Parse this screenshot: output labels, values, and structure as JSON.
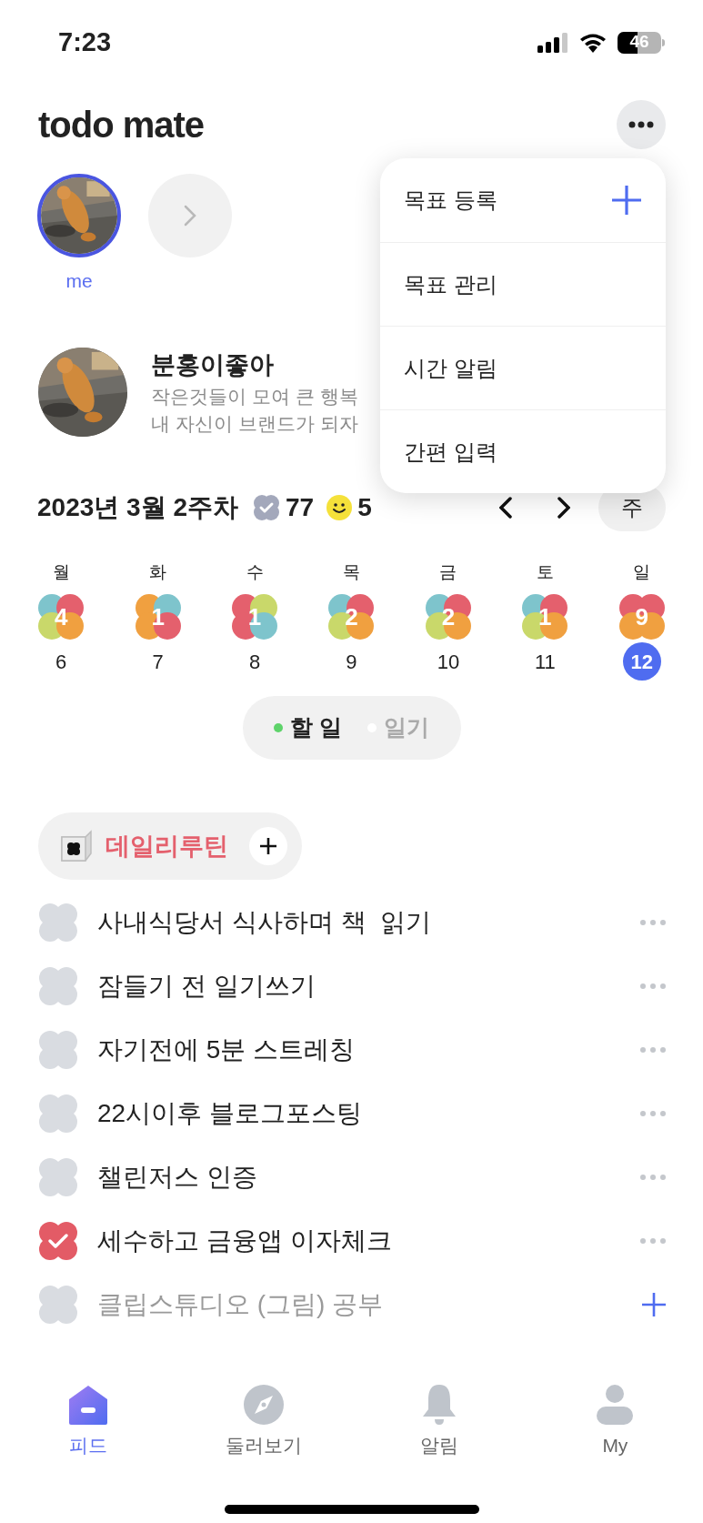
{
  "status_bar": {
    "time": "7:23",
    "battery": "46"
  },
  "header": {
    "title": "todo mate"
  },
  "friends": [
    {
      "name": "me",
      "selected": true
    }
  ],
  "menu": [
    {
      "label": "목표 등록",
      "add": true
    },
    {
      "label": "목표 관리",
      "add": false
    },
    {
      "label": "시간 알림",
      "add": false
    },
    {
      "label": "간편 입력",
      "add": false
    }
  ],
  "profile": {
    "name": "분홍이좋아",
    "bio": [
      "작은것들이 모여 큰 행복",
      "내 자신이 브랜드가 되자"
    ]
  },
  "week": {
    "title": "2023년 3월 2주차",
    "stats": [
      {
        "kind": "check",
        "value": "77"
      },
      {
        "kind": "smile",
        "value": "5"
      }
    ],
    "mode": "주"
  },
  "days": [
    {
      "weekday": "월",
      "count": "4",
      "date": "6",
      "selected": false,
      "petals": [
        {
          "color": "#7ec4cc"
        },
        {
          "color": "#e4606d"
        },
        {
          "color": "#c9d86a"
        },
        {
          "color": "#f0a040"
        }
      ]
    },
    {
      "weekday": "화",
      "count": "1",
      "date": "7",
      "selected": false,
      "petals": [
        {
          "color": "#f0a040"
        },
        {
          "color": "#7ec4cc"
        },
        {
          "color": "#f0a040"
        },
        {
          "color": "#e4606d"
        }
      ]
    },
    {
      "weekday": "수",
      "count": "1",
      "date": "8",
      "selected": false,
      "petals": [
        {
          "color": "#e4606d"
        },
        {
          "color": "#c9d86a"
        },
        {
          "color": "#e4606d"
        },
        {
          "color": "#7ec4cc"
        }
      ]
    },
    {
      "weekday": "목",
      "count": "2",
      "date": "9",
      "selected": false,
      "petals": [
        {
          "color": "#7ec4cc"
        },
        {
          "color": "#e4606d"
        },
        {
          "color": "#c9d86a"
        },
        {
          "color": "#f0a040"
        }
      ]
    },
    {
      "weekday": "금",
      "count": "2",
      "date": "10",
      "selected": false,
      "petals": [
        {
          "color": "#7ec4cc"
        },
        {
          "color": "#e4606d"
        },
        {
          "color": "#c9d86a"
        },
        {
          "color": "#f0a040"
        }
      ]
    },
    {
      "weekday": "토",
      "count": "1",
      "date": "11",
      "selected": false,
      "petals": [
        {
          "color": "#7ec4cc"
        },
        {
          "color": "#e4606d"
        },
        {
          "color": "#c9d86a"
        },
        {
          "color": "#f0a040"
        }
      ]
    },
    {
      "weekday": "일",
      "count": "9",
      "date": "12",
      "selected": true,
      "petals": [
        {
          "color": "#e4606d"
        },
        {
          "color": "#e4606d"
        },
        {
          "color": "#f0a040"
        },
        {
          "color": "#f0a040"
        }
      ]
    }
  ],
  "view_toggle": [
    {
      "label": "할 일",
      "selected": true
    },
    {
      "label": "일기",
      "selected": false
    }
  ],
  "category": {
    "label": "데일리루틴",
    "color": "#e4606d"
  },
  "todos": [
    {
      "text": "사내식당서 식사하며 책  읽기",
      "checked": false
    },
    {
      "text": "잠들기 전 일기쓰기",
      "checked": false
    },
    {
      "text": "자기전에 5분 스트레칭",
      "checked": false
    },
    {
      "text": "22시이후 블로그포스팅",
      "checked": false
    },
    {
      "text": "챌린저스 인증",
      "checked": false
    },
    {
      "text": "세수하고 금융앱 이자체크",
      "checked": true
    }
  ],
  "new_todo": {
    "placeholder": "클립스튜디오 (그림) 공부",
    "checked": false
  },
  "nav": [
    {
      "kind": "home",
      "label": "피드",
      "selected": true
    },
    {
      "kind": "compass",
      "label": "둘러보기",
      "selected": false
    },
    {
      "kind": "bell",
      "label": "알림",
      "selected": false
    },
    {
      "kind": "person",
      "label": "My",
      "selected": false
    }
  ]
}
